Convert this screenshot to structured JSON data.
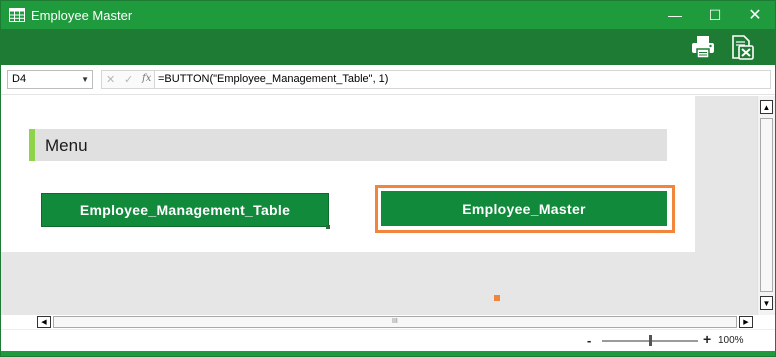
{
  "window": {
    "title": "Employee Master",
    "controls": {
      "minimize": "—",
      "maximize": "☐",
      "close": "✕"
    }
  },
  "toolbar": {
    "icons": [
      "printer-icon",
      "excel-export-icon"
    ]
  },
  "formula_bar": {
    "cell_reference": "D4",
    "dropdown_arrow": "▼",
    "cancel_glyph": "✕",
    "enter_glyph": "✓",
    "fx_label": "fx",
    "formula": "=BUTTON(\"Employee_Management_Table\", 1)"
  },
  "sheet": {
    "menu_heading": "Menu",
    "buttons": [
      {
        "label": "Employee_Management_Table"
      },
      {
        "label": "Employee_Master",
        "selected": true
      }
    ]
  },
  "scrollbars": {
    "up_arrow": "▲",
    "down_arrow": "▼",
    "left_arrow": "◀",
    "right_arrow": "▶",
    "grip": "III"
  },
  "status": {
    "zoom_out": "-",
    "zoom_in": "+",
    "zoom_level": "100%",
    "zoom_fraction": 0.5
  },
  "colors": {
    "title_bar": "#1f9b3e",
    "toolbar": "#1e7b34",
    "button_green": "#128a3c",
    "menu_accent": "#8ed34a",
    "selection_orange": "#f0853b"
  }
}
